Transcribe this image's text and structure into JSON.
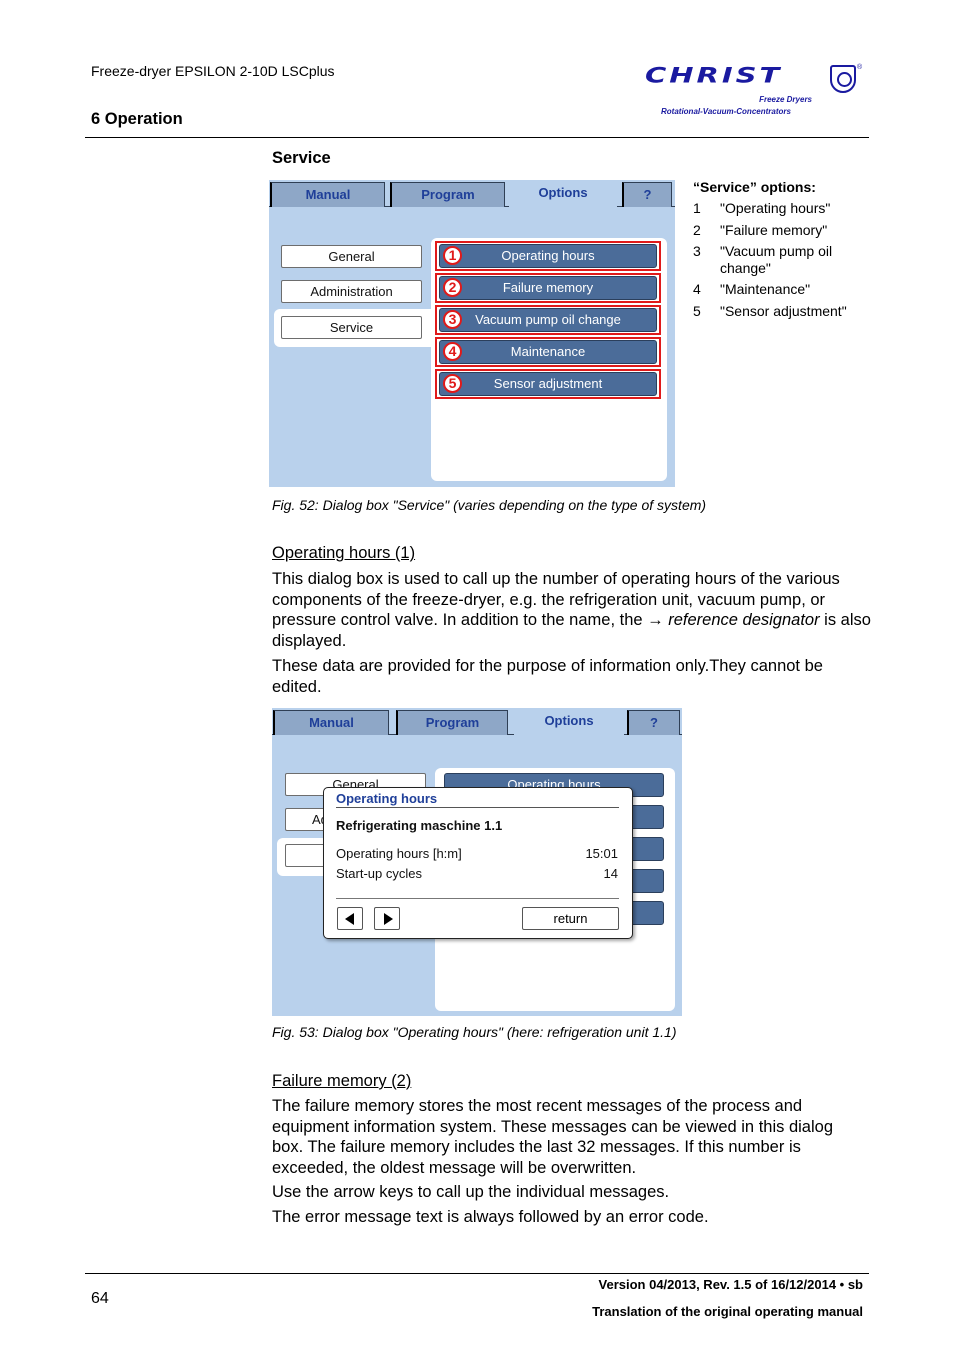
{
  "header": {
    "doc_title": "Freeze-dryer EPSILON 2-10D LSCplus",
    "chapter": "6 Operation",
    "logo": {
      "wordmark": "CHRIST",
      "tagline1": "Freeze Dryers",
      "tagline2": "Rotational-Vacuum-Concentrators",
      "registered": "®",
      "brand_color": "#1a1aa0"
    }
  },
  "section_title": "Service",
  "figure52": {
    "tabs": [
      "Manual",
      "Program",
      "Options",
      "?"
    ],
    "active_tab": "Options",
    "left_buttons": [
      "General",
      "Administration",
      "Service"
    ],
    "selected_left": "Service",
    "options": [
      {
        "num": "1",
        "label": "Operating hours"
      },
      {
        "num": "2",
        "label": "Failure memory"
      },
      {
        "num": "3",
        "label": "Vacuum pump oil change"
      },
      {
        "num": "4",
        "label": "Maintenance"
      },
      {
        "num": "5",
        "label": "Sensor adjustment"
      }
    ],
    "caption": "Fig. 52: Dialog box \"Service\" (varies depending on the type of system)"
  },
  "legend": {
    "heading": "“Service” options:",
    "items": [
      {
        "num": "1",
        "text": "\"Operating hours\""
      },
      {
        "num": "2",
        "text": "\"Failure memory\""
      },
      {
        "num": "3",
        "text": "\"Vacuum pump oil change\""
      },
      {
        "num": "4",
        "text": "\"Maintenance\""
      },
      {
        "num": "5",
        "text": "\"Sensor adjustment\""
      }
    ]
  },
  "operating_hours_section": {
    "heading": "Operating hours (1)",
    "para1_a": "This dialog box is used to call up the number of operating hours of the various components of the freeze-dryer, e.g. the refrigeration unit, vacuum pump, or pressure control valve. In addition to the name, the ",
    "para1_arrow": "→",
    "para1_ref": "reference designator",
    "para1_b": " is also displayed.",
    "para2": "These data are provided for the purpose of information only.They cannot be edited."
  },
  "figure53": {
    "tabs": [
      "Manual",
      "Program",
      "Options",
      "?"
    ],
    "active_tab": "Options",
    "left_buttons_visible": [
      "General",
      "Ad",
      ""
    ],
    "behind_option": "Operating hours",
    "dialog": {
      "title": "Operating hours",
      "subtitle": "Refrigerating maschine 1.1",
      "rows": [
        {
          "label": "Operating hours [h:m]",
          "value": "15:01"
        },
        {
          "label": "Start-up cycles",
          "value": "14"
        }
      ],
      "prev_icon": "arrow-left-icon",
      "next_icon": "arrow-right-icon",
      "return_label": "return"
    },
    "caption": "Fig. 53: Dialog box \"Operating hours\" (here: refrigeration unit 1.1)"
  },
  "failure_memory_section": {
    "heading": "Failure memory (2)",
    "para1": "The failure memory stores the most recent messages of the process and equipment information system. These messages can be viewed in this dialog box. The failure memory includes the last 32 messages. If this number is exceeded, the oldest message will be overwritten.",
    "para2": "Use the arrow keys to call up the individual messages.",
    "para3": "The error message text is always followed by an error code."
  },
  "footer": {
    "page_number": "64",
    "version": "Version 04/2013, Rev. 1.5 of 16/12/2014 • sb",
    "translation": "Translation of the original operating manual"
  }
}
